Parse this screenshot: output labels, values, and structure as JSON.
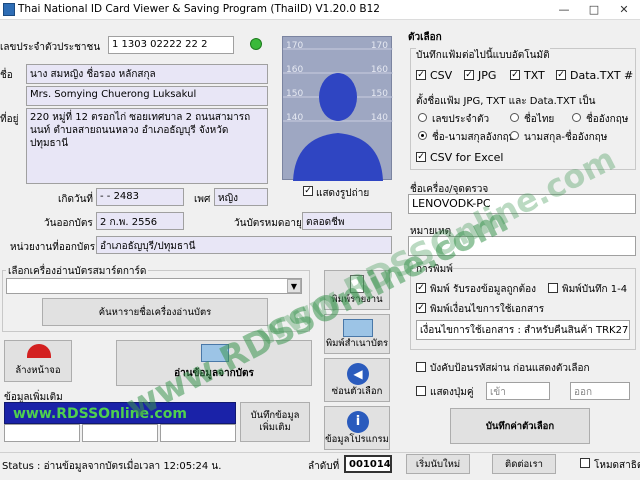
{
  "window": {
    "title": "Thai National ID Card Viewer & Saving Program (ThaiID) V1.20.0 B12"
  },
  "card": {
    "id_label": "เลขประจำตัวประชาชน",
    "id_value": "1 1303 02222 22 2",
    "name_label": "ชื่อ",
    "name_th": "นาง สมหญิง ชื่อรอง หลักสกุล",
    "name_en": "Mrs. Somying Chuerong Luksakul",
    "address_label": "ที่อยู่",
    "address": "220 หมู่ที่ 12 ตรอกไก่ ซอยเทศบาล 2 ถนนสามารถนนท์ ตำบลสายถนนหลวง อำเภอธัญบุรี จังหวัดปทุมธานี",
    "birth_label": "เกิดวันที่",
    "birth_value": "- - 2483",
    "sex_label": "เพศ",
    "sex_value": "หญิง",
    "issue_label": "วันออกบัตร",
    "issue_value": "2 ก.พ. 2556",
    "expire_label": "วันบัตรหมดอายุ",
    "expire_value": "ตลอดชีพ",
    "agency_label": "หน่วยงานที่ออกบัตร",
    "agency_value": "อำเภอธัญบุรี/ปทุมธานี",
    "show_photo_label": "แสดงรูปถ่าย"
  },
  "photo": {
    "scale_left": [
      "170",
      "160",
      "150",
      "140"
    ],
    "scale_right": [
      "170",
      "160",
      "150",
      "140"
    ]
  },
  "reader": {
    "label": "เลือกเครื่องอ่านบัตรสมาร์ตการ์ด",
    "search_button": "ค้นหารายชื่อเครื่องอ่านบัตร"
  },
  "actions": {
    "print_report": "พิมพ์รายงาน",
    "print_copy": "พิมพ์สำเนาบัตร",
    "hide_options": "ซ่อนตัวเลือก",
    "program_info": "ข้อมูลโปรแกรม",
    "clear_screen": "ล้างหน้าจอ",
    "read_card": "อ่านข้อมูลจากบัตร"
  },
  "extra": {
    "label": "ข้อมูลเพิ่มเติม",
    "save_button": "บันทึกข้อมูลเพิ่มเติม"
  },
  "watermark": {
    "banner": "www.RDSSOnline.com",
    "diag1": "www.RDSSOnline.com",
    "diag2": "www.RDSSOnline.com"
  },
  "status": {
    "text": "Status : อ่านข้อมูลจากบัตรเมื่อเวลา 12:05:24 น.",
    "seq_label": "ลำดับที่",
    "seq_value": "001014",
    "new_button": "เริ่มนับใหม่",
    "contact_button": "ติดต่อเรา",
    "new_version": "โหมดสาธิต"
  },
  "options": {
    "title": "ตัวเลือก",
    "autosave_label": "บันทึกแฟ้มต่อไปนี้แบบอัตโนมัติ",
    "formats": [
      "CSV",
      "JPG",
      "TXT",
      "Data.TXT #"
    ],
    "naming_label": "ตั้งชื่อแฟ้ม JPG, TXT และ Data.TXT เป็น",
    "naming": [
      "เลขประจำตัว",
      "ชื่อไทย",
      "ชื่ออังกฤษ",
      "ชื่อ-นามสกุลอังกฤษ",
      "นามสกุล-ชื่ออังกฤษ"
    ],
    "csv_excel": "CSV for Excel",
    "device_label": "ชื่อเครื่อง/จุดตรวจ",
    "device_value": "LENOVODK-PC",
    "note_label": "หมายเหตุ",
    "print_title": "การพิมพ์",
    "print_single": "พิมพ์ รับรองข้อมูลถูกต้อง",
    "print_multi": "พิมพ์บันทึก 1-4",
    "print_condition": "พิมพ์เงื่อนไขการใช้เอกสาร",
    "condition_value": "เงื่อนไขการใช้เอกสาร : สำหรับคืนสินค้า TRK2700F",
    "confirm_label": "บังคับป้อนรหัสผ่าน ก่อนแสดงตัวเลือก",
    "display_label": "แสดงปุ่มคู่",
    "enter_label": "เข้า",
    "exit_label": "ออก",
    "save_options": "บันทึกค่าตัวเลือก"
  },
  "colors": {
    "photo_bg": "#9ea7c2",
    "person": "#2f45c2",
    "field_lav": "#e8e6f6",
    "watermark": "#3c9650",
    "red": "#d32020",
    "banner_blue": "#1a22a8",
    "green_led": "#3ab93a"
  }
}
